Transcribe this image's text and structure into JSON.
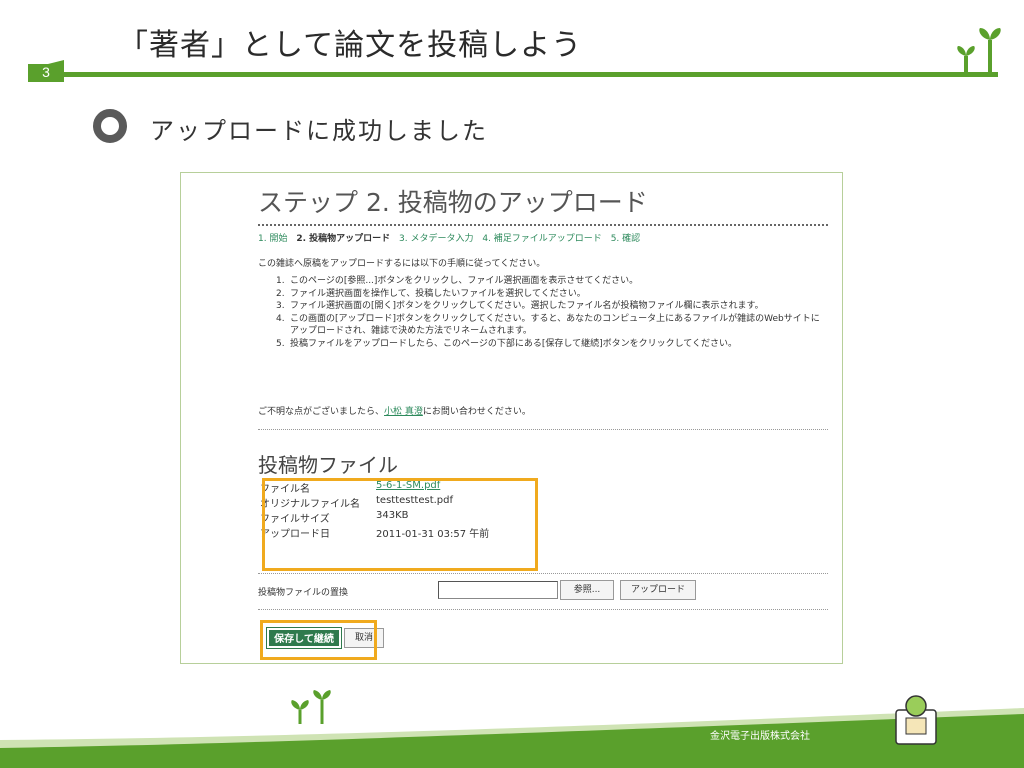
{
  "header": {
    "number": "3",
    "title": "「著者」として論文を投稿しよう"
  },
  "section": {
    "title": "アップロードに成功しました"
  },
  "screen": {
    "step_title": "ステップ 2. 投稿物のアップロード",
    "breadcrumbs": [
      "1. 開始",
      "2. 投稿物アップロード",
      "3. メタデータ入力",
      "4. 補足ファイルアップロード",
      "5. 確認"
    ],
    "intro": "この雑誌へ原稿をアップロードするには以下の手順に従ってください。",
    "steps": [
      "このページの[参照...]ボタンをクリックし、ファイル選択画面を表示させてください。",
      "ファイル選択画面を操作して、投稿したいファイルを選択してください。",
      "ファイル選択画面の[開く]ボタンをクリックしてください。選択したファイル名が投稿物ファイル欄に表示されます。",
      "この画面の[アップロード]ボタンをクリックしてください。すると、あなたのコンピュータ上にあるファイルが雑誌のWebサイトにアップロードされ、雑誌で決めた方法でリネームされます。",
      "投稿ファイルをアップロードしたら、このページの下部にある[保存して継続]ボタンをクリックしてください。"
    ],
    "step_numbers": [
      "1.",
      "2.",
      "3.",
      "4.",
      "5."
    ],
    "contact_prefix": "ご不明な点がございましたら、",
    "contact_name": "小松 真澄",
    "contact_suffix": "にお問い合わせください。",
    "files_title": "投稿物ファイル",
    "file_meta": {
      "filename_label": "ファイル名",
      "filename_value": "5-6-1-SM.pdf",
      "original_label": "オリジナルファイル名",
      "original_value": "testtesttest.pdf",
      "size_label": "ファイルサイズ",
      "size_value": "343KB",
      "date_label": "アップロード日",
      "date_value": "2011-01-31 03:57 午前"
    },
    "replace_label": "投稿物ファイルの置換",
    "file_input_value": "",
    "browse_button": "参照...",
    "upload_button": "アップロード",
    "save_button": "保存して継続",
    "cancel_button": "取消"
  },
  "footer": {
    "brand": "金沢電子出版株式会社"
  },
  "colors": {
    "accent_green": "#5aa02c",
    "dark_green": "#2f7a4d",
    "highlight": "#f0aa1e",
    "frame_border": "#b7cf9a"
  }
}
